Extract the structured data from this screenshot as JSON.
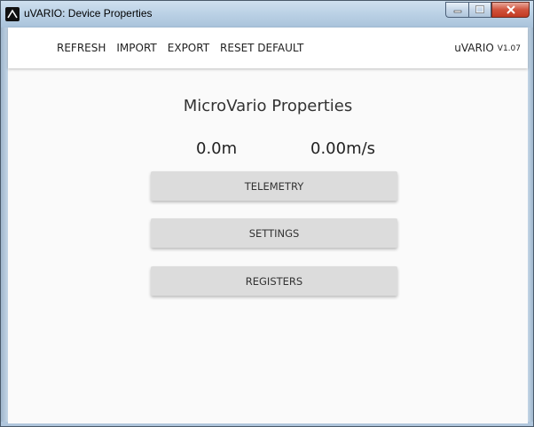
{
  "window": {
    "title": "uVARIO: Device Properties",
    "icon": "app-logo-icon",
    "controls": [
      "minimize-icon",
      "maximize-icon",
      "close-icon"
    ]
  },
  "toolbar": {
    "menu": [
      {
        "label": "REFRESH"
      },
      {
        "label": "IMPORT"
      },
      {
        "label": "EXPORT"
      },
      {
        "label": "RESET DEFAULT"
      }
    ],
    "app_name": "uVARIO",
    "version": "V1.07"
  },
  "main": {
    "title": "MicroVario Properties",
    "altitude": "0.0m",
    "vertical_speed": "0.00m/s",
    "buttons": [
      {
        "label": "TELEMETRY"
      },
      {
        "label": "SETTINGS"
      },
      {
        "label": "REGISTERS"
      }
    ]
  }
}
